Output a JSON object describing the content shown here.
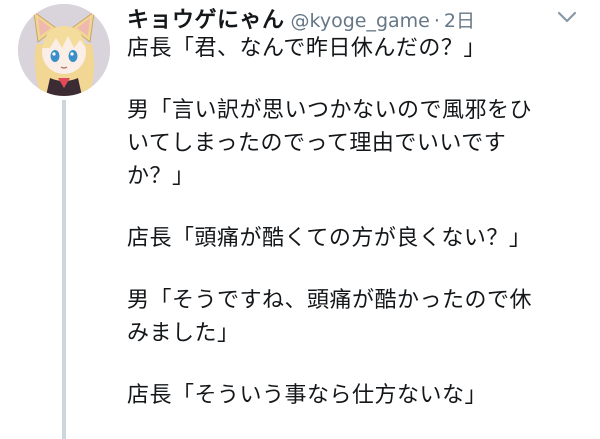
{
  "author": {
    "display_name": "キョウゲにゃん",
    "handle": "@kyoge_game",
    "separator": "·",
    "timestamp": "2日",
    "avatar_icon": "anime-cat-girl-avatar"
  },
  "menu": {
    "icon": "chevron-down-icon"
  },
  "tweet": {
    "paragraphs": [
      [
        "店長「君、なんで昨日休んだの？」"
      ],
      [
        "男「言い訳が思いつかないので風邪をひ",
        "いてしまったのでって理由でいいです",
        "か？」"
      ],
      [
        "店長「頭痛が酷くての方が良くない？」"
      ],
      [
        "男「そうですね、頭痛が酷かったので休",
        "みました」"
      ],
      [
        "店長「そういう事なら仕方ないな」"
      ]
    ]
  },
  "colors": {
    "text": "#14171a",
    "secondary": "#657786",
    "thread_line": "#ccd6dd"
  }
}
